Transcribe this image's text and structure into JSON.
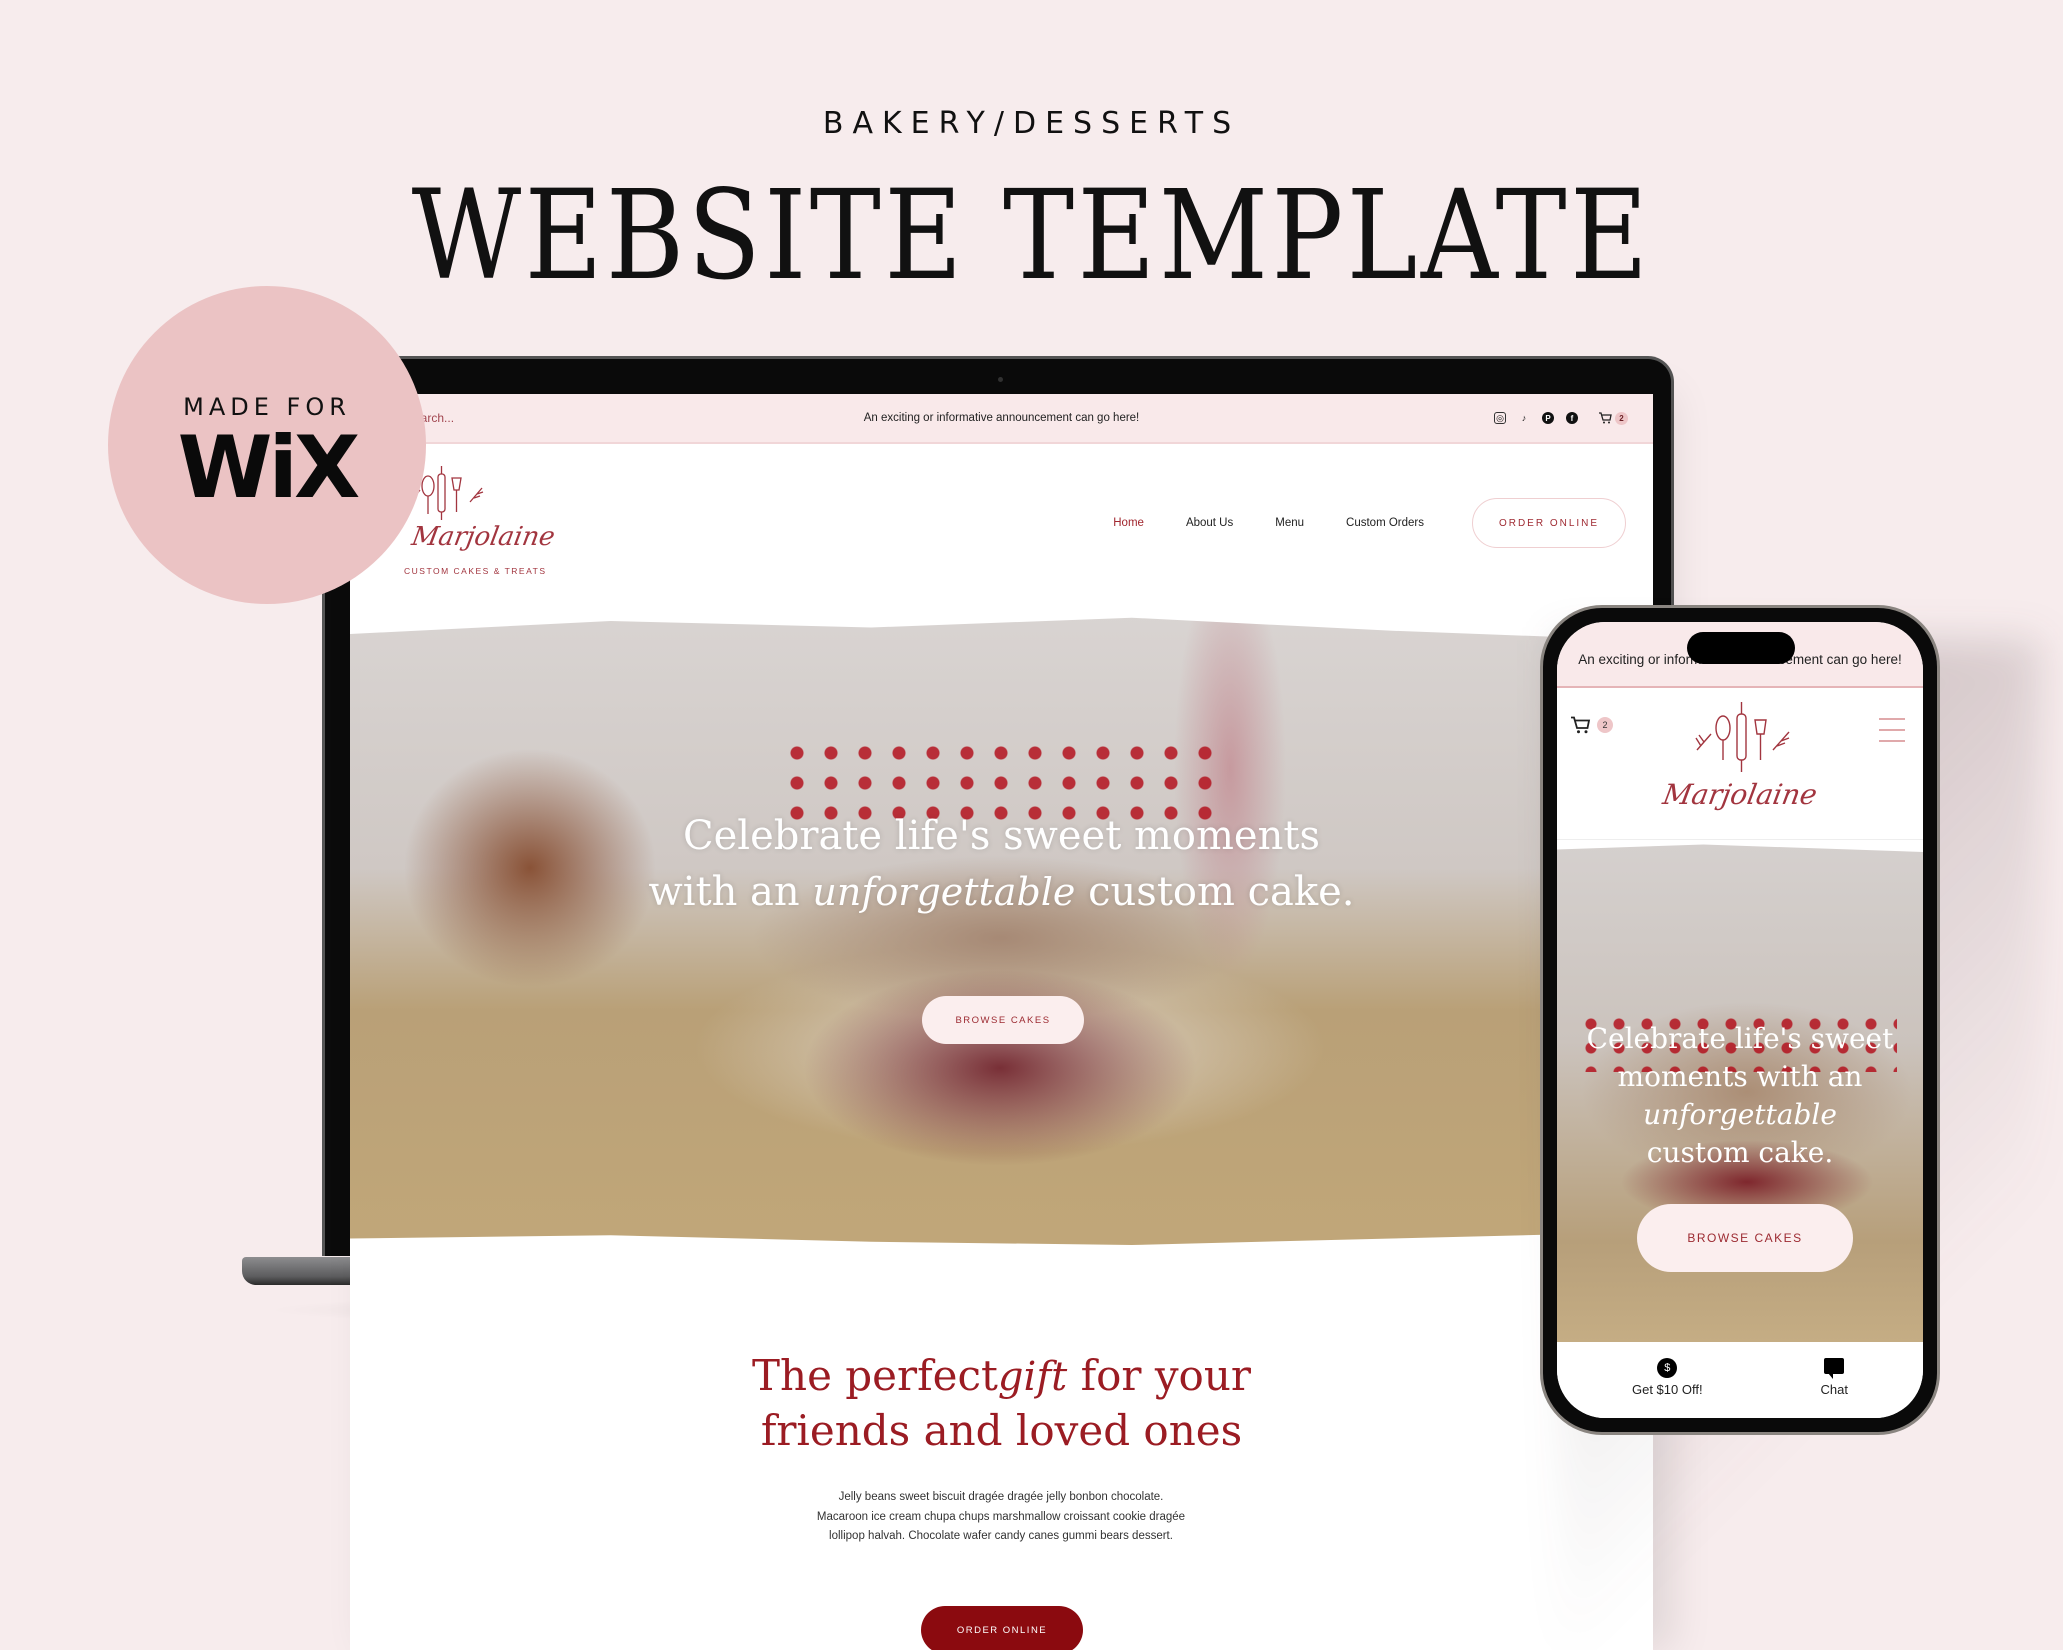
{
  "header": {
    "eyebrow": "BAKERY/DESSERTS",
    "title": "WEBSITE TEMPLATE"
  },
  "badge": {
    "made_for": "MADE FOR",
    "platform": "WiX",
    "color": "#ebc3c4"
  },
  "desktop": {
    "announcement_bar": {
      "search_placeholder": "Search...",
      "text": "An exciting or informative announcement can go here!",
      "socials": [
        "instagram-icon",
        "tiktok-icon",
        "pinterest-icon",
        "facebook-icon"
      ],
      "cart_count": "2"
    },
    "brand": {
      "name": "Marjolaine",
      "tagline": "CUSTOM CAKES & TREATS"
    },
    "nav": {
      "items": [
        {
          "label": "Home",
          "active": true
        },
        {
          "label": "About Us",
          "active": false
        },
        {
          "label": "Menu",
          "active": false
        },
        {
          "label": "Custom Orders",
          "active": false
        }
      ],
      "cta": "ORDER ONLINE"
    },
    "hero": {
      "line1": "Celebrate life's sweet moments",
      "line2_pre": "with an",
      "line2_script": "unforgettable",
      "line2_post": "custom cake.",
      "button": "BROWSE CAKES"
    },
    "gift_section": {
      "title_pre": "The perfect",
      "title_script": "gift",
      "title_post": "for your",
      "title_line2": "friends and loved ones",
      "body": "Jelly beans sweet biscuit dragée dragée jelly bonbon chocolate. Macaroon ice cream chupa chups marshmallow croissant cookie dragée lollipop halvah. Chocolate wafer candy canes gummi bears dessert.",
      "button": "ORDER ONLINE"
    },
    "colors": {
      "accent": "#8b0a0f",
      "announcement_bg": "#f9e9ea",
      "background": "#f7eced"
    }
  },
  "mobile": {
    "announcement": "An exciting or informative announcement can go here!",
    "cart_count": "2",
    "brand": "Marjolaine",
    "hero": {
      "line1": "Celebrate life's sweet",
      "line2": "moments with an",
      "line3_script": "unforgettable",
      "line4": "custom cake.",
      "button": "BROWSE CAKES"
    },
    "bottom_bar": [
      {
        "icon": "dollar-icon",
        "label": "Get $10 Off!"
      },
      {
        "icon": "chat-icon",
        "label": "Chat"
      }
    ]
  }
}
